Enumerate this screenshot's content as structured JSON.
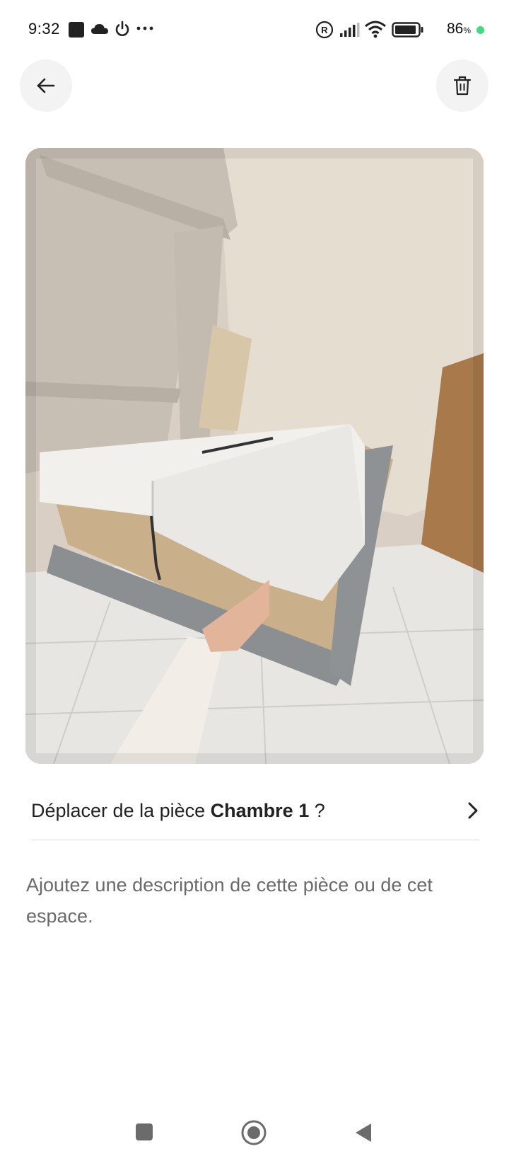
{
  "status_bar": {
    "time": "9:32",
    "battery_percent": "86",
    "battery_unit": "%",
    "icons": [
      "notification-square-icon",
      "cloud-icon",
      "power-icon",
      "more-dots-icon",
      "registered-icon",
      "signal-icon",
      "wifi-icon",
      "battery-icon"
    ],
    "dot_color": "#3ddc84"
  },
  "header": {
    "back_icon": "arrow-left-icon",
    "delete_icon": "trash-icon"
  },
  "photo": {
    "subject": "photo-of-bed"
  },
  "move_room": {
    "prefix": "Déplacer de la pièce",
    "room_name": "Chambre 1",
    "suffix": "?",
    "chevron_icon": "chevron-right-icon"
  },
  "description": {
    "placeholder": "Ajoutez une description de cette pièce ou de cet espace."
  },
  "nav_bar": {
    "icons": [
      "recents-square-icon",
      "home-circle-icon",
      "back-triangle-icon"
    ]
  }
}
